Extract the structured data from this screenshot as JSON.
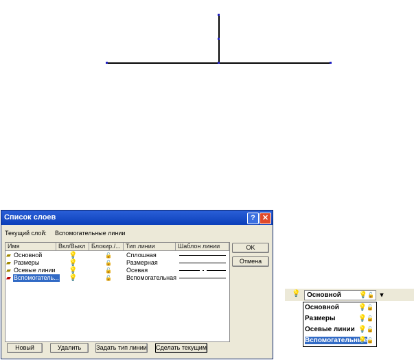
{
  "dialog": {
    "title": "Список слоев",
    "current_layer_label": "Текущий слой:",
    "current_layer_value": "Вспомогательные линии",
    "columns": [
      "Имя",
      "Вкл/Выкл",
      "Блокир./...",
      "Тип линии",
      "Шаблон линии"
    ],
    "rows": [
      {
        "name": "Основной",
        "type": "Сплошная",
        "pattern": "solid"
      },
      {
        "name": "Размеры",
        "type": "Размерная",
        "pattern": "solid"
      },
      {
        "name": "Осевые линии",
        "type": "Осевая",
        "pattern": "dash-dot"
      },
      {
        "name": "Вспомогатель...",
        "type": "Вспомогательная",
        "pattern": "solid",
        "selected": true
      }
    ],
    "ok": "OK",
    "cancel": "Отмена",
    "new": "Новый",
    "delete": "Удалить",
    "set_type": "Задать тип линии",
    "make_current": "Сделать текущим",
    "help": "?",
    "close": "✕"
  },
  "toolbar": {
    "combo_value": "Основной",
    "items": [
      "Основной",
      "Размеры",
      "Осевые линии",
      "Вспомогательные"
    ],
    "selected_index": 3
  },
  "icons": {
    "bulb": "💡",
    "lock": "🔓",
    "arrow": "▾"
  }
}
